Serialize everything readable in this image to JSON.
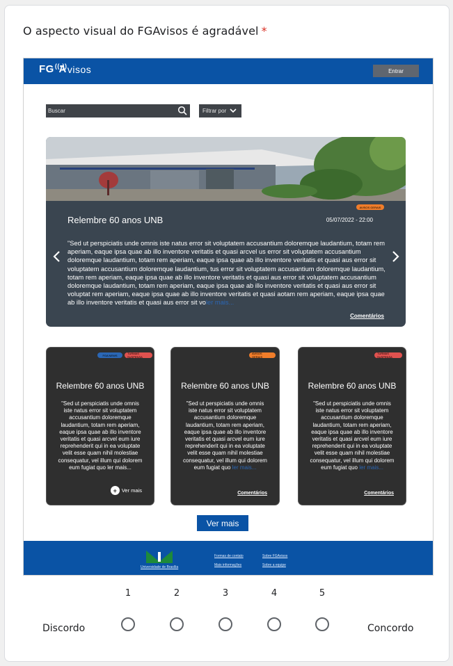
{
  "question": {
    "text": "O aspecto visual do FGAvisos é agradável",
    "required_mark": "*"
  },
  "mockup": {
    "header": {
      "logo_main": "FG",
      "logo_a": "A",
      "logo_rest": "visos",
      "login_button": "Entrar",
      "color": "#0a53a5"
    },
    "search": {
      "placeholder": "Buscar"
    },
    "filter": {
      "label": "Filtrar por"
    },
    "hero": {
      "tag": "AVISOS GERAIS",
      "title": "Relembre 60 anos UNB",
      "date": "05/07/2022 - 22:00",
      "text": "\"Sed ut perspiciatis unde omnis iste natus error sit voluptatem accusantium doloremque laudantium, totam rem aperiam, eaque ipsa quae ab illo inventore veritatis et quasi arcvel us error sit voluptatem accusantium doloremque laudantium, totam rem aperiam, eaque ipsa quae ab illo inventore veritatis et quasi aus error sit voluptatem accusantium doloremque laudantium, tus error sit voluptatem accusantium doloremque laudantium, totam rem aperiam, eaque ipsa quae ab illo inventore veritatis et quasi aus error sit voluptatem accusantium doloremque laudantium, totam rem aperiam, eaque ipsa quae ab illo inventore veritatis et quasi aus error sit voluptat rem aperiam, eaque ipsa quae ab illo inventore veritatis et quasi aotam rem aperiam, eaque ipsa quae ab illo inventore veritatis et quasi aus error sit vo",
      "more_link": "ler mais...",
      "comments": "Comentários"
    },
    "cards": [
      {
        "tags": [
          {
            "label": "FGA NEWS",
            "color": "#2b67b5"
          },
          {
            "label": "TURMAS SUSPENSA",
            "color": "#e0524f"
          }
        ],
        "title": "Relembre 60 anos UNB",
        "text": "\"Sed ut perspiciatis unde omnis iste natus error sit voluptatem accusantium doloremque laudantium, totam rem aperiam, eaque ipsa quae ab illo inventore veritatis et quasi arcvel eum iure reprehenderit qui in ea voluptate velit esse quam nihil molestiae consequatur, vel illum qui dolorem eum fugiat quo ler mais...",
        "more_link": "",
        "action": "Ver mais"
      },
      {
        "tags": [
          {
            "label": "AVISOS GERAIS",
            "color": "#f0a050"
          }
        ],
        "title": "Relembre 60 anos UNB",
        "text": "\"Sed ut perspiciatis unde omnis iste natus error sit voluptatem accusantium doloremque laudantium, totam rem aperiam, eaque ipsa quae ab illo inventore veritatis et quasi arcvel eum iure reprehenderit qui in ea voluptate velit esse quam nihil molestiae consequatur, vel illum qui dolorem eum fugiat quo",
        "more_link": "ler mais...",
        "action": "Comentários"
      },
      {
        "tags": [
          {
            "label": "TURMAS SUSPENSA",
            "color": "#e0524f"
          }
        ],
        "title": "Relembre 60 anos UNB",
        "text": "\"Sed ut perspiciatis unde omnis iste natus error sit voluptatem accusantium doloremque laudantium, totam rem aperiam, eaque ipsa quae ab illo inventore veritatis et quasi arcvel eum iure reprehenderit qui in ea voluptate velit esse quam nihil molestiae consequatur, vel illum qui dolorem eum fugiat quo",
        "more_link": "ler mais...",
        "action": "Comentários"
      }
    ],
    "see_more_button": "Ver mais",
    "footer": {
      "unb_label": "Universidade de Brasília",
      "links": [
        "Formas de contato",
        "Mais informações",
        "Sobre FGAvisos",
        "Sobre a equipe"
      ]
    }
  },
  "scale": {
    "numbers": [
      "1",
      "2",
      "3",
      "4",
      "5"
    ],
    "left_label": "Discordo",
    "right_label": "Concordo",
    "selected": null
  }
}
